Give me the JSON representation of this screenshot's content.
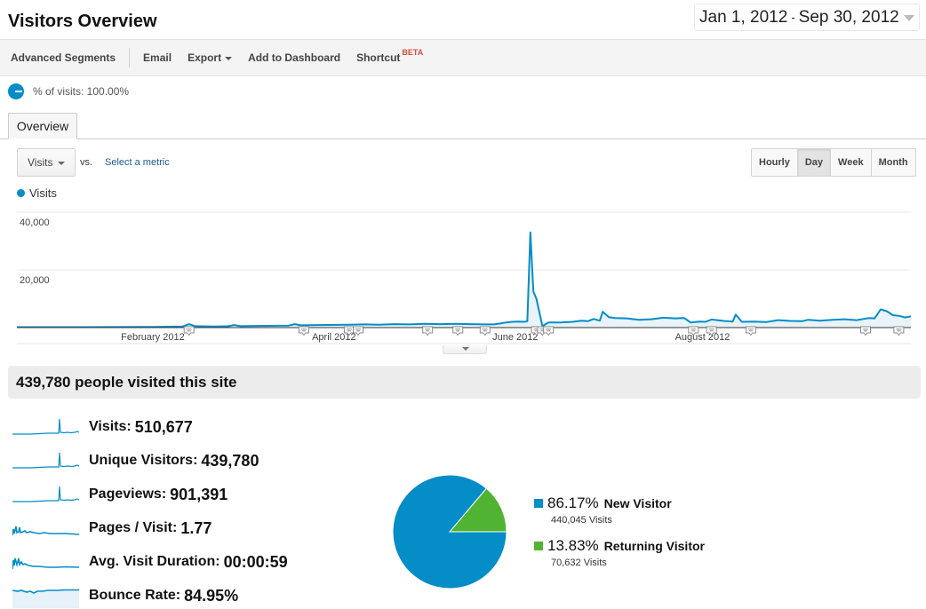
{
  "header": {
    "title": "Visitors Overview",
    "date_start": "Jan 1, 2012",
    "date_sep": "-",
    "date_end": "Sep 30, 2012"
  },
  "toolbar": {
    "advanced_segments": "Advanced Segments",
    "email": "Email",
    "export": "Export",
    "add_to_dashboard": "Add to Dashboard",
    "shortcut": "Shortcut",
    "beta": "BETA"
  },
  "segment": {
    "label": "% of visits: 100.00%"
  },
  "tabs": [
    {
      "label": "Overview",
      "active": true
    }
  ],
  "controls": {
    "metric": "Visits",
    "vs": "vs.",
    "select_metric": "Select a metric",
    "granularity": [
      {
        "label": "Hourly",
        "active": false
      },
      {
        "label": "Day",
        "active": true
      },
      {
        "label": "Week",
        "active": false
      },
      {
        "label": "Month",
        "active": false
      }
    ]
  },
  "colors": {
    "primary": "#058dc7",
    "secondary": "#50b432",
    "fill": "#e8f3fa",
    "accent_beta": "#dd4b39"
  },
  "chart_data": {
    "type": "area",
    "title": "",
    "legend": [
      "Visits"
    ],
    "legend_position": "top-left",
    "ylabel": "",
    "xlabel": "",
    "ylim": [
      0,
      40000
    ],
    "yticks": [
      "40,000",
      "20,000"
    ],
    "ytick_values": [
      40000,
      20000
    ],
    "grid": true,
    "xtick_labels": [
      "February 2012",
      "April 2012",
      "June 2012",
      "August 2012"
    ],
    "xtick_days": [
      45,
      105,
      165,
      227
    ],
    "x_range_days": [
      0,
      273
    ],
    "series": [
      {
        "name": "Visits",
        "points": [
          [
            0,
            150
          ],
          [
            10,
            150
          ],
          [
            20,
            160
          ],
          [
            30,
            180
          ],
          [
            40,
            200
          ],
          [
            45,
            250
          ],
          [
            50,
            300
          ],
          [
            55,
            400
          ],
          [
            57,
            1200
          ],
          [
            59,
            500
          ],
          [
            65,
            400
          ],
          [
            70,
            450
          ],
          [
            72,
            900
          ],
          [
            74,
            500
          ],
          [
            80,
            600
          ],
          [
            90,
            700
          ],
          [
            92,
            1200
          ],
          [
            94,
            800
          ],
          [
            100,
            900
          ],
          [
            110,
            1000
          ],
          [
            115,
            1100
          ],
          [
            120,
            1000
          ],
          [
            125,
            1200
          ],
          [
            130,
            1100
          ],
          [
            135,
            1300
          ],
          [
            140,
            1200
          ],
          [
            145,
            1300
          ],
          [
            150,
            1200
          ],
          [
            155,
            1100
          ],
          [
            158,
            1100
          ],
          [
            160,
            1400
          ],
          [
            162,
            1800
          ],
          [
            164,
            2000
          ],
          [
            166,
            2100
          ],
          [
            168,
            2000
          ],
          [
            169,
            2200
          ],
          [
            170,
            33000
          ],
          [
            171,
            12500
          ],
          [
            172,
            10000
          ],
          [
            174,
            500
          ],
          [
            176,
            1800
          ],
          [
            180,
            1800
          ],
          [
            184,
            2000
          ],
          [
            187,
            2400
          ],
          [
            189,
            2200
          ],
          [
            191,
            3000
          ],
          [
            193,
            2400
          ],
          [
            194,
            5500
          ],
          [
            196,
            3600
          ],
          [
            198,
            3300
          ],
          [
            202,
            3200
          ],
          [
            206,
            2700
          ],
          [
            210,
            2900
          ],
          [
            214,
            3400
          ],
          [
            218,
            3200
          ],
          [
            221,
            3300
          ],
          [
            223,
            1800
          ],
          [
            226,
            2100
          ],
          [
            228,
            2000
          ],
          [
            230,
            2800
          ],
          [
            234,
            2300
          ],
          [
            237,
            2100
          ],
          [
            238,
            4500
          ],
          [
            240,
            2000
          ],
          [
            244,
            2100
          ],
          [
            248,
            1900
          ],
          [
            252,
            2600
          ],
          [
            256,
            2300
          ],
          [
            260,
            2200
          ],
          [
            262,
            2700
          ],
          [
            266,
            2400
          ],
          [
            270,
            2700
          ],
          [
            274,
            2900
          ],
          [
            278,
            2600
          ],
          [
            282,
            3300
          ],
          [
            284,
            3200
          ],
          [
            286,
            6300
          ],
          [
            288,
            5700
          ],
          [
            290,
            4300
          ],
          [
            292,
            4100
          ],
          [
            294,
            3500
          ],
          [
            296,
            3900
          ]
        ]
      }
    ],
    "annotations_days": [
      57,
      95,
      110,
      113,
      136,
      146,
      155,
      172,
      174,
      176,
      224,
      230,
      243,
      281,
      292
    ]
  },
  "summary": {
    "headline": "439,780 people visited this site",
    "metrics": [
      {
        "label": "Visits:",
        "value": "510,677",
        "spark": "spike"
      },
      {
        "label": "Unique Visitors:",
        "value": "439,780",
        "spark": "spike"
      },
      {
        "label": "Pageviews:",
        "value": "901,391",
        "spark": "spike"
      },
      {
        "label": "Pages / Visit:",
        "value": "1.77",
        "spark": "decay"
      },
      {
        "label": "Avg. Visit Duration:",
        "value": "00:00:59",
        "spark": "decay2"
      },
      {
        "label": "Bounce Rate:",
        "value": "84.95%",
        "spark": "flat"
      }
    ]
  },
  "visitor_type": {
    "slices": [
      {
        "pct_label": "86.17%",
        "pct": 86.17,
        "name": "New Visitor",
        "visits": "440,045 Visits",
        "color": "#058dc7"
      },
      {
        "pct_label": "13.83%",
        "pct": 13.83,
        "name": "Returning Visitor",
        "visits": "70,632 Visits",
        "color": "#50b432"
      }
    ]
  }
}
